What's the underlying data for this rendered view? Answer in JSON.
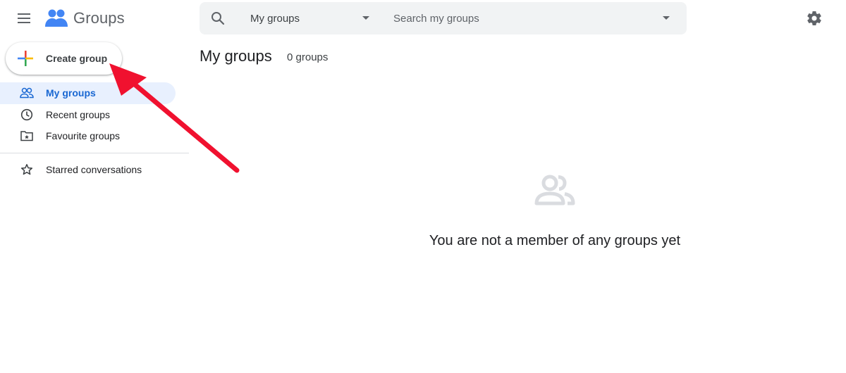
{
  "header": {
    "app_name": "Groups",
    "search": {
      "scope_selected": "My groups",
      "placeholder": "Search my groups",
      "value": ""
    }
  },
  "sidebar": {
    "create_button_label": "Create group",
    "items": [
      {
        "label": "My groups",
        "icon": "people-icon",
        "active": true
      },
      {
        "label": "Recent groups",
        "icon": "clock-icon",
        "active": false
      },
      {
        "label": "Favourite groups",
        "icon": "folder-star-icon",
        "active": false
      },
      {
        "label": "Starred conversations",
        "icon": "star-icon",
        "active": false
      }
    ]
  },
  "main": {
    "title": "My groups",
    "count": "0 groups",
    "empty_message": "You are not a member of any groups yet"
  },
  "colors": {
    "accent": "#1967d2",
    "active_bg": "#e8f0fe",
    "search_bg": "#f1f3f4",
    "annotation_arrow": "#f0112f"
  }
}
